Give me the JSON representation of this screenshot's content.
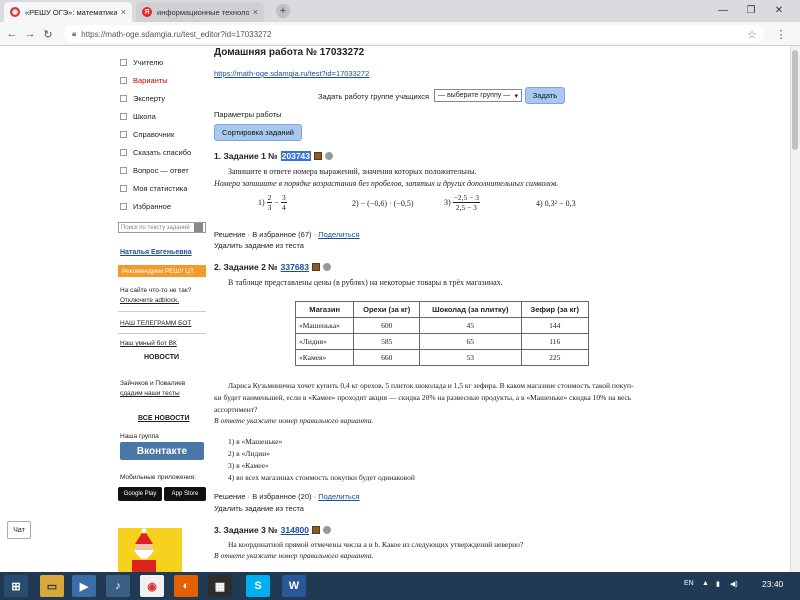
{
  "browser": {
    "tabs": [
      {
        "title": "«РЕШУ ОГЭ»: математика. ОГЭ —",
        "favicon": "reshu-logo-icon",
        "active": true
      },
      {
        "title": "информационные технологии на у",
        "favicon": "yandex-icon",
        "active": false
      }
    ],
    "new_tab": "+",
    "url": "https://math-oge.sdamgia.ru/test_editor?id=17033272"
  },
  "sidebar": {
    "menu": [
      {
        "label": "Учителю",
        "red": false
      },
      {
        "label": "Варианты",
        "red": true
      },
      {
        "label": "Эксперту",
        "red": false
      },
      {
        "label": "Школа",
        "red": false
      },
      {
        "label": "Справочник",
        "red": false
      },
      {
        "label": "Сказать спасибо",
        "red": false
      },
      {
        "label": "Вопрос — ответ",
        "red": false
      },
      {
        "label": "Моя статистика",
        "red": false
      },
      {
        "label": "Избранное",
        "red": false
      }
    ],
    "search_placeholder": "Поиск по тексту заданий",
    "user_name": "Наталья Евгеньевна",
    "promo": "Рекомендуем РЕШУ ЦТ",
    "error_text": "На сайте что-то не так?",
    "error_link": "Отключите adblock.",
    "telegram": "НАШ ТЕЛЕГРАММ БОТ",
    "vk_bot": "Наш умный бот ВК",
    "news_title": "НОВОСТИ",
    "news_text": "Зайчиков и Повалиев",
    "news_link": "сдадим наши тесты",
    "all_news": "ВСЕ НОВОСТИ",
    "group_label": "Наша группа",
    "vk_button": "Вконтакте",
    "mobile_label": "Мобильные приложения:",
    "google_play": "Google Play",
    "app_store": "App Store"
  },
  "main": {
    "title": "Домашняя работа № 17033272",
    "test_link": "https://math-oge.sdamgia.ru/test?id=17033272",
    "assign_label": "Задать работу группе учащихся",
    "group_select": "— выберите группу —",
    "assign_button": "Задать",
    "params_link": "Параметры работы",
    "sort_button": "Сортировка заданий",
    "task1": {
      "head": "1. Задание 1 №",
      "number": "203743",
      "text": "Запишите в ответе номера выражений, значения которых положительны.",
      "note": "Номера запишите в порядке возрастания без пробелов, запятых и других дополнительных символов.",
      "opt1_label": "1)",
      "opt1_a_num": "2",
      "opt1_a_den": "3",
      "opt1_op": "−",
      "opt1_b_num": "3",
      "opt1_b_den": "4",
      "opt2": "2)  − (−0,6) · (−0,5)",
      "opt3_label": "3)",
      "opt3_num": "−2,5 − 3",
      "opt3_den": "2,5 − 3",
      "opt4": "4)  0,3² − 0,3",
      "solution": "Решение · В избранное (67) ·",
      "share": "Поделиться",
      "delete": "Удалить задание из теста"
    },
    "task2": {
      "head": "2. Задание 2 №",
      "number": "337683",
      "intro": "В таблице представлены цены (в рублях) на некоторые товары в трёх магазинах.",
      "table_headers": [
        "Магазин",
        "Орехи (за кг)",
        "Шоколад (за плитку)",
        "Зефир (за кг)"
      ],
      "table_rows": [
        [
          "«Машенька»",
          "600",
          "45",
          "144"
        ],
        [
          "«Лидия»",
          "585",
          "65",
          "116"
        ],
        [
          "«Камея»",
          "660",
          "53",
          "225"
        ]
      ],
      "problem_1": "Лариса Кузьминична хочет купить 0,4 кг орехов, 5 плиток шоколада и 1,5 кг зефира. В каком магазине стоимость такой покуп-",
      "problem_2": "ки будет наименьшей, если в «Камее» проходит акция — скидка 20% на развесные продукты, а в «Машеньке» скидка 10% на весь",
      "problem_3": "ассортимент?",
      "answer_note": "В ответе укажите номер правильного варианта.",
      "options": [
        "1) в «Машеньке»",
        "2) в «Лидии»",
        "3) в «Камее»",
        "4) во всех магазинах стоимость покупки будет одинаковой"
      ],
      "solution": "Решение · В избранное (20) ·",
      "share": "Поделиться",
      "delete": "Удалить задание из теста"
    },
    "task3": {
      "head": "3. Задание 3 №",
      "number": "314800",
      "text": "На координатной прямой отмечены числа a и b. Какое из следующих утверждений неверно?",
      "note": "В ответе укажите номер правильного варианта."
    }
  },
  "chat_button": "Чат",
  "taskbar": {
    "lang": "EN",
    "time": "23:40"
  },
  "colors": {
    "link": "#1a4fa0",
    "button": "#a8c8ef",
    "vk": "#4a76a8",
    "promo": "#f39a2c",
    "taskbar": "#1f3a52"
  }
}
